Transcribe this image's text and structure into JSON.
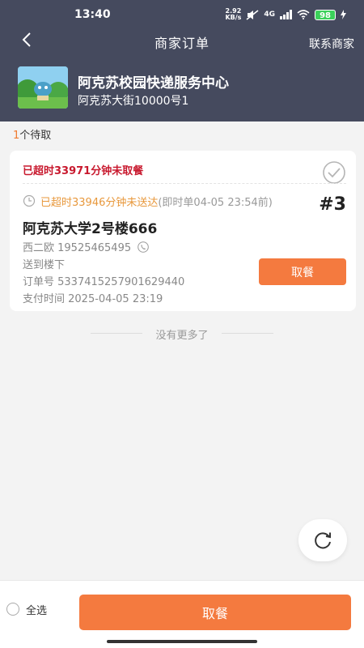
{
  "status_bar": {
    "time": "13:40",
    "net_speed_value": "2.92",
    "net_speed_unit": "KB/s",
    "network": "4G",
    "battery": "98",
    "icons": [
      "mute-icon",
      "signal-icon",
      "wifi-icon",
      "battery-icon",
      "charging-icon"
    ]
  },
  "nav": {
    "title": "商家订单",
    "contact": "联系商家",
    "back_icon": "chevron-left-icon"
  },
  "shop": {
    "name": "阿克苏校园快递服务中心",
    "address": "阿克苏大街10000号1"
  },
  "pending": {
    "count": "1",
    "label": "个待取"
  },
  "order": {
    "pickup_overtime": "已超时33971分钟未取餐",
    "delivery_overtime": "已超时33946分钟未送达",
    "order_type": "(即时单04-05 23:54前)",
    "number": "#3",
    "address": "阿克苏大学2号楼666",
    "customer": "西二欧 19525465495",
    "delivery_note": "送到楼下",
    "order_id": "订单号 5337415257901629440",
    "pay_time": "支付时间 2025-04-05 23:19",
    "pickup_button": "取餐"
  },
  "list_end": "没有更多了",
  "bottom": {
    "select_all": "全选",
    "pickup_button": "取餐"
  },
  "colors": {
    "header_bg": "#454a5e",
    "accent": "#f47a3f",
    "warning_red": "#c8192e",
    "warning_orange": "#e8983c"
  }
}
